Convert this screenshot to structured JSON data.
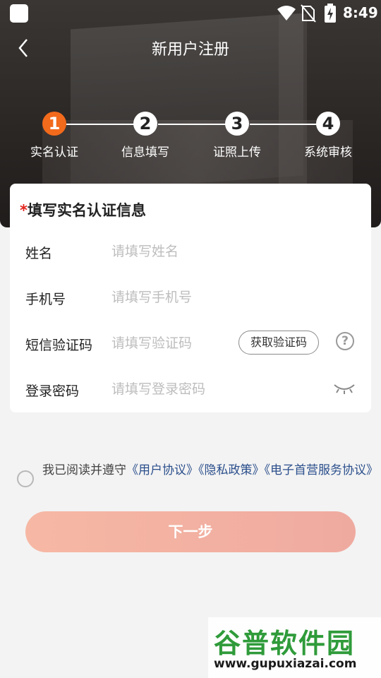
{
  "status_bar": {
    "time": "8:49"
  },
  "header": {
    "title": "新用户注册",
    "back_icon": "chevron-left-icon"
  },
  "steps": [
    {
      "num": "1",
      "label": "实名认证",
      "active": true
    },
    {
      "num": "2",
      "label": "信息填写",
      "active": false
    },
    {
      "num": "3",
      "label": "证照上传",
      "active": false
    },
    {
      "num": "4",
      "label": "系统审核",
      "active": false
    }
  ],
  "form": {
    "title_star": "*",
    "title": "填写实名认证信息",
    "name": {
      "label": "姓名",
      "placeholder": "请填写姓名",
      "value": ""
    },
    "phone": {
      "label": "手机号",
      "placeholder": "请填写手机号",
      "value": ""
    },
    "sms": {
      "label": "短信验证码",
      "placeholder": "请填写验证码",
      "value": "",
      "button": "获取验证码",
      "help": "?"
    },
    "password": {
      "label": "登录密码",
      "placeholder": "请填写登录密码",
      "value": ""
    }
  },
  "agreement": {
    "prefix": "我已阅读并遵守",
    "user_agreement": "《用户协议》",
    "privacy_policy": "《隐私政策》",
    "service_agreement": "《电子首营服务协议》",
    "checked": false
  },
  "next_button": "下一步",
  "watermark": {
    "title": "谷普软件园",
    "url": "www.gupuxiazai.com"
  },
  "colors": {
    "accent": "#f26a1b",
    "button": "#efaaa0",
    "link": "#2b4f8c",
    "required": "#e2231a"
  }
}
